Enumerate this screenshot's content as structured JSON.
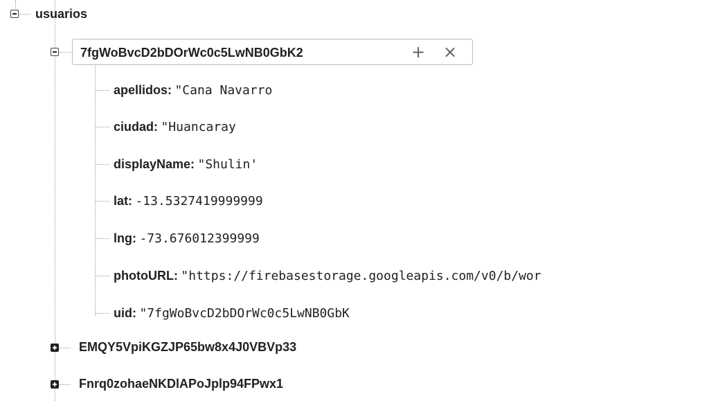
{
  "tree": {
    "root_label": "usuarios",
    "expanded_node": {
      "key": "7fgWoBvcD2bDOrWc0c5LwNB0GbK2",
      "add_label": "+",
      "delete_label": "×",
      "fields": [
        {
          "key": "apellidos:",
          "value": "\"Cana Navarro"
        },
        {
          "key": "ciudad:",
          "value": "\"Huancaray"
        },
        {
          "key": "displayName:",
          "value": "\"Shulin'"
        },
        {
          "key": "lat:",
          "value": "-13.5327419999999"
        },
        {
          "key": "lng:",
          "value": "-73.676012399999"
        },
        {
          "key": "photoURL:",
          "value": "\"https://firebasestorage.googleapis.com/v0/b/wor"
        },
        {
          "key": "uid:",
          "value": "\"7fgWoBvcD2bDOrWc0c5LwNB0GbK"
        }
      ]
    },
    "collapsed_nodes": [
      {
        "key": "EMQY5VpiKGZJP65bw8x4J0VBVp33"
      },
      {
        "key": "Fnrq0zohaeNKDlAPoJplp94FPwx1"
      }
    ]
  },
  "colors": {
    "text": "#212121",
    "guide": "#9e9e9e",
    "border": "#bdbdbd"
  }
}
